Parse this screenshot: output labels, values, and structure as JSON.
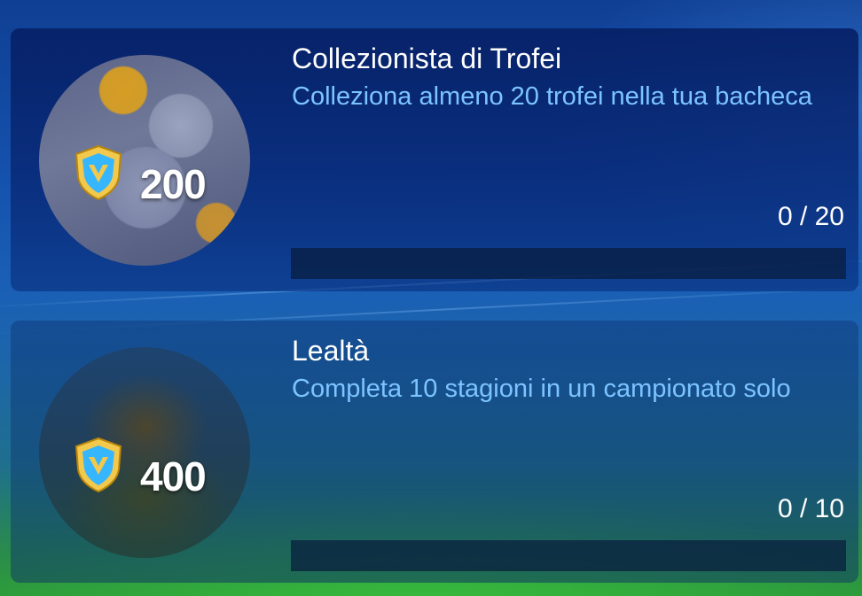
{
  "achievements": [
    {
      "title": "Collezionista di Trofei",
      "description": "Colleziona almeno 20 trofei nella tua bacheca",
      "points": "200",
      "progress_text": "0 / 20",
      "progress_value": 0,
      "progress_max": 20,
      "badge_icon": "trophy-collection-icon"
    },
    {
      "title": "Lealtà",
      "description": "Completa 10 stagioni in un campionato solo",
      "points": "400",
      "progress_text": "0 / 10",
      "progress_value": 0,
      "progress_max": 10,
      "badge_icon": "mascot-icon"
    }
  ],
  "colors": {
    "accent_text": "#7cc4ff",
    "shield_gold": "#f2c94c",
    "shield_blue": "#35b6ff"
  }
}
